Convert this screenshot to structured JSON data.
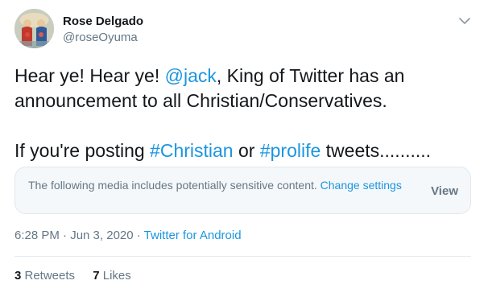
{
  "author": {
    "display_name": "Rose Delgado",
    "handle": "@roseOyuma",
    "avatar_icon": "religious-art-avatar"
  },
  "menu_icon": "chevron-down-icon",
  "tweet": {
    "line1": {
      "before": "Hear ye! Hear ye! ",
      "mention": "@jack",
      "after": ", King of Twitter has an"
    },
    "line2": "announcement to all Christian/Conservatives.",
    "line3": {
      "before": "If you're posting ",
      "hashtag1": "#Christian",
      "middle": " or ",
      "hashtag2": "#prolife",
      "after": " tweets.........."
    }
  },
  "sensitive_notice": {
    "message": "The following media includes potentially sensitive content. ",
    "link": "Change settings",
    "view_label": "View"
  },
  "meta": {
    "time_date": "6:28 PM · Jun 3, 2020 · ",
    "source": "Twitter for Android"
  },
  "stats": {
    "retweets_count": "3",
    "retweets_label": " Retweets",
    "likes_count": "7",
    "likes_label": " Likes"
  },
  "colors": {
    "link": "#1b95e0",
    "secondary_text": "#657786",
    "primary_text": "#14171a",
    "notice_bg": "#f5f8fa"
  }
}
